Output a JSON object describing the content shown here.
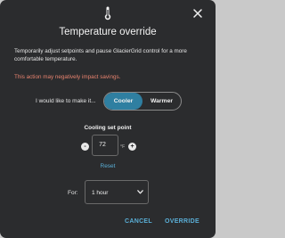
{
  "dialog": {
    "title": "Temperature override",
    "description": "Temporarily adjust setpoints and pause GlacierGrid control for a more comfortable temperature.",
    "warning": "This action may negatively impact savings.",
    "make_label": "I would like to make it...",
    "toggle": {
      "options": [
        "Cooler",
        "Warmer"
      ],
      "selected": "Cooler"
    },
    "setpoint": {
      "label": "Cooling set point",
      "minus": "-",
      "plus": "+",
      "value": "72",
      "unit": "°F"
    },
    "reset_label": "Reset",
    "duration": {
      "label": "For:",
      "value": "1 hour"
    },
    "footer": {
      "cancel_label": "CANCEL",
      "override_label": "OVERRIDE"
    },
    "colors": {
      "background": "#2b2c2e",
      "accent": "#5aaed6",
      "toggle_active": "#2f7fa1",
      "warning": "#e8836f"
    },
    "icons": {
      "header": "thermometer-icon",
      "close": "close-icon",
      "dropdown": "chevron-down-icon"
    }
  }
}
